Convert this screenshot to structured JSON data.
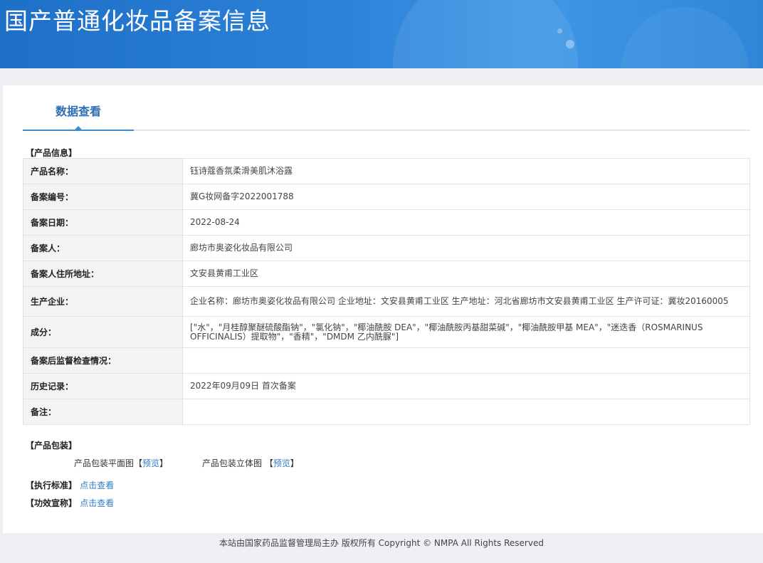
{
  "header": {
    "title": "国产普通化妆品备案信息"
  },
  "tabs": [
    {
      "label": "数据查看"
    }
  ],
  "product_info": {
    "section_label": "【产品信息】",
    "rows": [
      {
        "label": "产品名称：",
        "value": "钰诗蔻香氛柔滑美肌沐浴露"
      },
      {
        "label": "备案编号：",
        "value": "冀G妆网备字2022001788"
      },
      {
        "label": "备案日期：",
        "value": "2022-08-24"
      },
      {
        "label": "备案人：",
        "value": "廊坊市奥姿化妆品有限公司"
      },
      {
        "label": "备案人住所地址：",
        "value": "文安县黄甫工业区"
      },
      {
        "label": "生产企业：",
        "value": "企业名称：廊坊市奥姿化妆品有限公司 企业地址：文安县黄甫工业区 生产地址：河北省廊坊市文安县黄甫工业区 生产许可证：冀妆20160005"
      },
      {
        "label": "成分：",
        "value": "[\"水\"，\"月桂醇聚醚硫酸酯钠\"，\"氯化钠\"，\"椰油酰胺 DEA\"，\"椰油酰胺丙基甜菜碱\"，\"椰油酰胺甲基 MEA\"，\"迷迭香（ROSMARINUS OFFICINALIS）提取物\"，\"香精\"，\"DMDM 乙内酰脲\"]"
      },
      {
        "label": "备案后监督检查情况：",
        "value": ""
      },
      {
        "label": "历史记录：",
        "value": "2022年09月09日 首次备案"
      },
      {
        "label": "备注：",
        "value": ""
      }
    ]
  },
  "packaging": {
    "section_label": "【产品包装】",
    "flat_label": "产品包装平面图",
    "stereo_label": "产品包装立体图",
    "bracket_open": "【",
    "bracket_close": "】",
    "preview_label": "预览"
  },
  "standard": {
    "label": "【执行标准】",
    "link": "点击查看"
  },
  "efficacy": {
    "label": "【功效宣称】",
    "link": "点击查看"
  },
  "footer": {
    "text": "本站由国家药品监督管理局主办 版权所有 Copyright © NMPA All Rights Reserved"
  }
}
